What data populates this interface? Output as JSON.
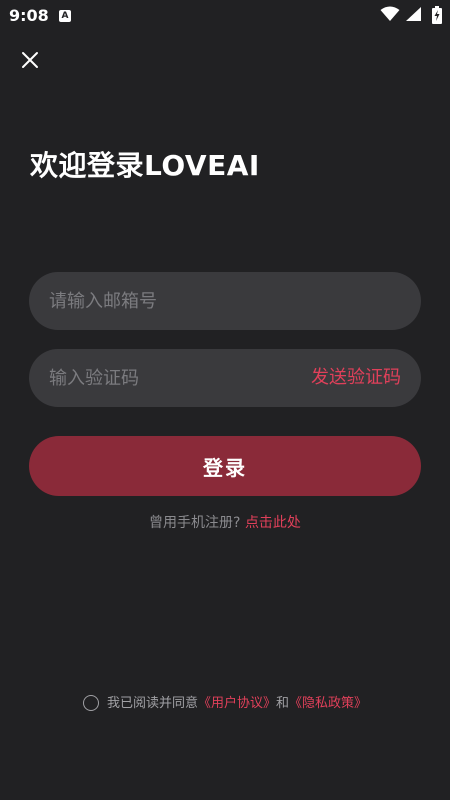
{
  "status_bar": {
    "time": "9:08",
    "app_icon_letter": "A",
    "icons": [
      "wifi-icon",
      "signal-icon",
      "battery-icon"
    ]
  },
  "header": {
    "close_icon": "close-icon"
  },
  "title": "欢迎登录LOVEAI",
  "form": {
    "email_placeholder": "请输入邮箱号",
    "email_value": "",
    "code_placeholder": "输入验证码",
    "code_value": "",
    "send_code_label": "发送验证码",
    "login_label": "登录"
  },
  "register": {
    "prompt": "曾用手机注册?",
    "link": "点击此处"
  },
  "agreement": {
    "checked": false,
    "prefix": "我已阅读并同意",
    "user_agreement": "《用户协议》",
    "connector": "和",
    "privacy_policy": "《隐私政策》"
  },
  "colors": {
    "background": "#212123",
    "field": "#3a3a3d",
    "accent": "#e0405a",
    "button": "#8a2a39"
  }
}
